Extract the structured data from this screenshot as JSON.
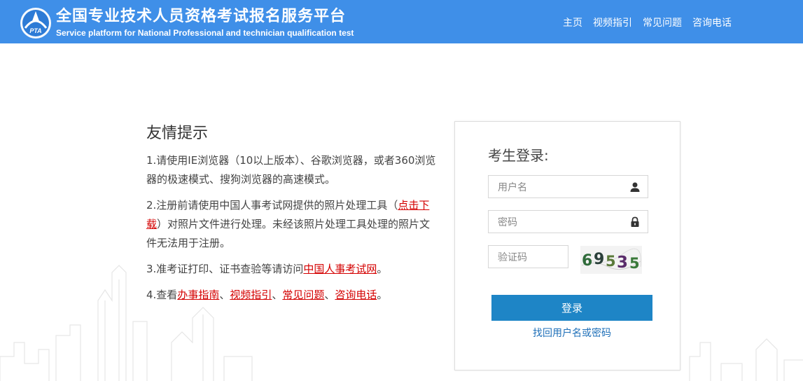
{
  "header": {
    "title_cn": "全国专业技术人员资格考试报名服务平台",
    "title_en": "Service platform for National Professional and technician qualification test",
    "logo_text": "PTA",
    "nav": [
      "主页",
      "视频指引",
      "常见问题",
      "咨询电话"
    ]
  },
  "tips": {
    "title": "友情提示",
    "tip1": "1.请使用IE浏览器（10以上版本）、谷歌浏览器，或者360浏览器的极速模式、搜狗浏览器的高速模式。",
    "tip2_pre": "2.注册前请使用中国人事考试网提供的照片处理工具（",
    "tip2_link": "点击下载",
    "tip2_post": "）对照片文件进行处理。未经该照片处理工具处理的照片文件无法用于注册。",
    "tip3_pre": "3.准考证打印、证书查验等请访问",
    "tip3_link": "中国人事考试网",
    "tip3_post": "。",
    "tip4_pre": "4.查看",
    "tip4_links": [
      "办事指南",
      "视频指引",
      "常见问题",
      "咨询电话"
    ],
    "tip4_sep": "、",
    "tip4_post": "。"
  },
  "login": {
    "title": "考生登录:",
    "username_placeholder": "用户名",
    "password_placeholder": "密码",
    "captcha_placeholder": "验证码",
    "captcha_text": [
      "6",
      "9",
      "5",
      "3",
      "5"
    ],
    "submit": "登录",
    "forgot": "找回用户名或密码"
  },
  "colors": {
    "header_bg": "#3f8fe8",
    "button_bg": "#1e85c6",
    "link_red": "#d40000",
    "link_blue": "#1e6fb8"
  }
}
